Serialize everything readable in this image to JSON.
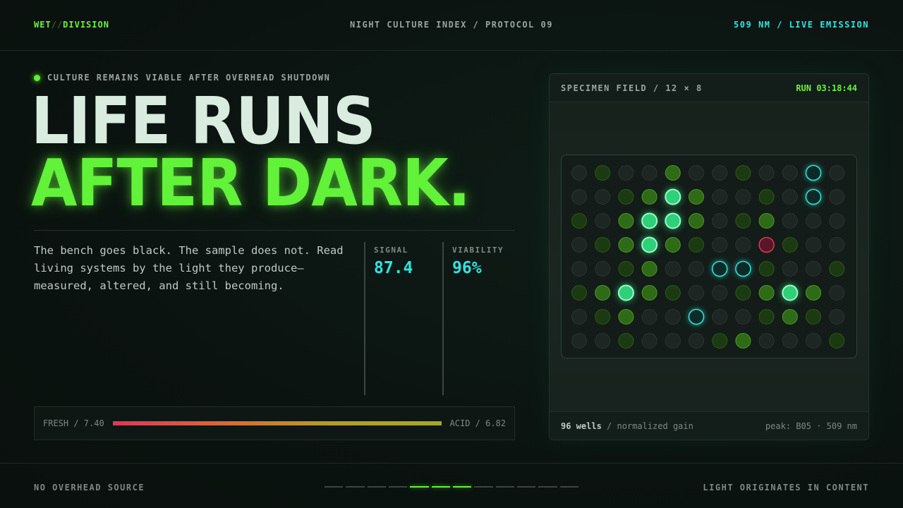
{
  "header": {
    "brand_left": "WET",
    "brand_sep": "//",
    "brand_right": "DIVISION",
    "center": "NIGHT CULTURE INDEX / PROTOCOL 09",
    "right": "509 NM / LIVE EMISSION"
  },
  "hero": {
    "eyebrow": "CULTURE REMAINS VIABLE AFTER OVERHEAD SHUTDOWN",
    "line1": "LIFE RUNS",
    "line2": "AFTER DARK.",
    "body": "The bench goes black. The sample does not. Read living systems by the light they produce—measured, altered, and still becoming."
  },
  "stats": [
    {
      "label": "SIGNAL",
      "value": "87.4"
    },
    {
      "label": "VIABILITY",
      "value": "96%"
    }
  ],
  "ph_scale": {
    "left": "FRESH / 7.40",
    "right": "ACID / 6.82"
  },
  "panel": {
    "title": "SPECIMEN FIELD / 12 × 8",
    "run": "RUN 03:18:44",
    "footer_count": "96 wells",
    "footer_rest": "/ normalized gain",
    "footer_peak": "peak: B05 · 509 nm",
    "colors": {
      "0": "#1d2622",
      "1": "#1b3a12",
      "2": "#2f6a17",
      "3": "#2ed07a",
      "4": "#0e2a27",
      "5": "#5a1628"
    },
    "wells": [
      [
        0,
        1,
        0,
        0,
        2,
        0,
        0,
        1,
        0,
        0,
        4,
        0
      ],
      [
        0,
        0,
        1,
        2,
        3,
        2,
        0,
        0,
        1,
        0,
        4,
        0
      ],
      [
        1,
        0,
        2,
        3,
        3,
        2,
        0,
        1,
        2,
        0,
        0,
        0
      ],
      [
        0,
        1,
        2,
        3,
        2,
        1,
        0,
        0,
        5,
        1,
        0,
        0
      ],
      [
        0,
        0,
        1,
        2,
        0,
        0,
        4,
        4,
        1,
        0,
        0,
        1
      ],
      [
        1,
        2,
        3,
        2,
        1,
        0,
        0,
        1,
        2,
        3,
        2,
        0
      ],
      [
        0,
        1,
        2,
        0,
        0,
        4,
        0,
        0,
        1,
        2,
        1,
        0
      ],
      [
        0,
        0,
        1,
        0,
        0,
        0,
        1,
        2,
        0,
        0,
        0,
        1
      ]
    ]
  },
  "footer": {
    "left": "NO OVERHEAD SOURCE",
    "right": "LIGHT ORIGINATES IN CONTENT",
    "pager_total": 12,
    "pager_active": [
      4,
      5,
      6
    ]
  }
}
